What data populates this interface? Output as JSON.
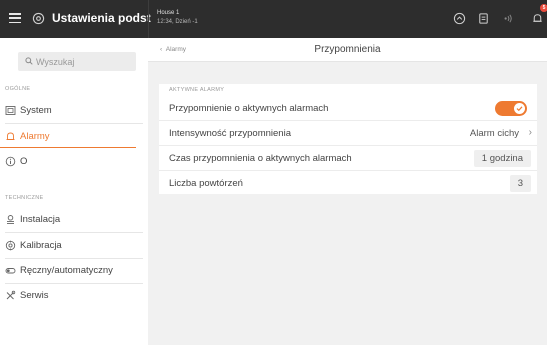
{
  "topbar": {
    "title": "Ustawienia podst",
    "house": "House 1",
    "datetime": "12:34, Dzień -1",
    "notification_count": "5"
  },
  "sidebar": {
    "search_placeholder": "Wyszukaj",
    "sections": [
      {
        "title": "OGÓLNE",
        "items": [
          {
            "label": "System",
            "icon": "system-icon"
          },
          {
            "label": "Alarmy",
            "icon": "bell-icon",
            "active": true
          },
          {
            "label": "O",
            "icon": "info-icon"
          }
        ]
      },
      {
        "title": "TECHNICZNE",
        "items": [
          {
            "label": "Instalacja",
            "icon": "installation-icon"
          },
          {
            "label": "Kalibracja",
            "icon": "calibration-icon"
          },
          {
            "label": "Ręczny/automatyczny",
            "icon": "manual-auto-icon"
          },
          {
            "label": "Serwis",
            "icon": "service-icon"
          }
        ]
      }
    ]
  },
  "main": {
    "back_label": "Alarmy",
    "page_title": "Przypomnienia",
    "group_title": "AKTYWNE ALARMY",
    "rows": [
      {
        "label": "Przypomnienie o aktywnych alarmach",
        "toggle": true
      },
      {
        "label": "Intensywność przypomnienia",
        "value": "Alarm cichy"
      },
      {
        "label": "Czas przypomnienia o aktywnych alarmach",
        "value": "1 godzina"
      },
      {
        "label": "Liczba powtórzeń",
        "value": "3"
      }
    ]
  },
  "colors": {
    "accent": "#ee7a31",
    "topbar": "#2d2d2d",
    "badge": "#e84c3d"
  }
}
